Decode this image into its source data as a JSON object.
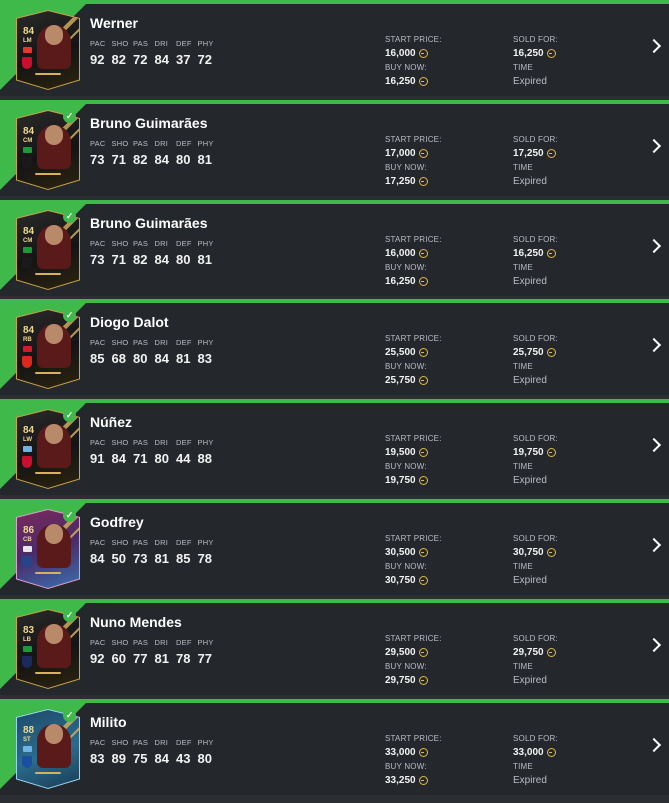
{
  "labels": {
    "start_price": "START PRICE:",
    "buy_now": "BUY NOW:",
    "sold_for": "SOLD FOR:",
    "time": "TIME"
  },
  "stat_headers": [
    "PAC",
    "SHO",
    "PAS",
    "DRI",
    "DEF",
    "PHY"
  ],
  "colors": {
    "accent": "#3fb94a",
    "row_bg": "#24272c",
    "coin": "#e3b93a",
    "card_gold": "#c9a24a"
  },
  "transfers": [
    {
      "name": "Werner",
      "rating": "84",
      "position": "LM",
      "card_style": "gold",
      "stats": [
        "92",
        "82",
        "72",
        "84",
        "37",
        "72"
      ],
      "start_price": "16,000",
      "buy_now": "16,250",
      "sold_for": "16,250",
      "time": "Expired",
      "flag_color": "#e23a2a",
      "club_color": "#c8102e",
      "sold_check": false
    },
    {
      "name": "Bruno Guimarães",
      "rating": "84",
      "position": "CM",
      "card_style": "gold",
      "stats": [
        "73",
        "71",
        "82",
        "84",
        "80",
        "81"
      ],
      "start_price": "17,000",
      "buy_now": "17,250",
      "sold_for": "17,250",
      "time": "Expired",
      "flag_color": "#1c9a3a",
      "club_color": "#1a1a1a",
      "sold_check": true
    },
    {
      "name": "Bruno Guimarães",
      "rating": "84",
      "position": "CM",
      "card_style": "gold",
      "stats": [
        "73",
        "71",
        "82",
        "84",
        "80",
        "81"
      ],
      "start_price": "16,000",
      "buy_now": "16,250",
      "sold_for": "16,250",
      "time": "Expired",
      "flag_color": "#1c9a3a",
      "club_color": "#1a1a1a",
      "sold_check": true
    },
    {
      "name": "Diogo Dalot",
      "rating": "84",
      "position": "RB",
      "card_style": "gold",
      "stats": [
        "85",
        "68",
        "80",
        "84",
        "81",
        "83"
      ],
      "start_price": "25,500",
      "buy_now": "25,750",
      "sold_for": "25,750",
      "time": "Expired",
      "flag_color": "#d11a2a",
      "club_color": "#da291c",
      "sold_check": true
    },
    {
      "name": "Núñez",
      "rating": "84",
      "position": "LW",
      "card_style": "gold",
      "stats": [
        "91",
        "84",
        "71",
        "80",
        "44",
        "88"
      ],
      "start_price": "19,500",
      "buy_now": "19,750",
      "sold_for": "19,750",
      "time": "Expired",
      "flag_color": "#6fb3e6",
      "club_color": "#c8102e",
      "sold_check": true
    },
    {
      "name": "Godfrey",
      "rating": "86",
      "position": "CB",
      "card_style": "pink",
      "stats": [
        "84",
        "50",
        "73",
        "81",
        "85",
        "78"
      ],
      "start_price": "30,500",
      "buy_now": "30,750",
      "sold_for": "30,750",
      "time": "Expired",
      "flag_color": "#e6e6e6",
      "club_color": "#274488",
      "sold_check": true
    },
    {
      "name": "Nuno Mendes",
      "rating": "83",
      "position": "LB",
      "card_style": "gold",
      "stats": [
        "92",
        "60",
        "77",
        "81",
        "78",
        "77"
      ],
      "start_price": "29,500",
      "buy_now": "29,750",
      "sold_for": "29,750",
      "time": "Expired",
      "flag_color": "#1c9a3a",
      "club_color": "#1b2a5a",
      "sold_check": true
    },
    {
      "name": "Milito",
      "rating": "88",
      "position": "ST",
      "card_style": "teal",
      "stats": [
        "83",
        "89",
        "75",
        "84",
        "43",
        "80"
      ],
      "start_price": "33,000",
      "buy_now": "33,250",
      "sold_for": "33,000",
      "time": "Expired",
      "flag_color": "#6fb3e6",
      "club_color": "#1a4fa0",
      "sold_check": true
    }
  ]
}
